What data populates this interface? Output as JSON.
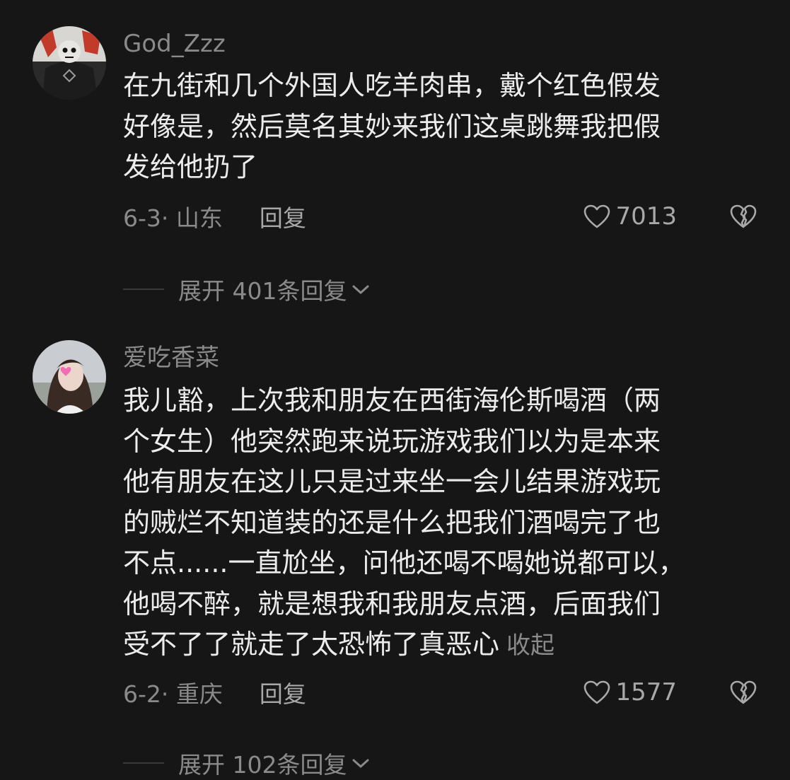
{
  "comments": [
    {
      "username": "God_Zzz",
      "lines": [
        "在九街和几个外国人吃羊肉串，戴个红色假发",
        "好像是，然后莫名其妙来我们这桌跳舞我把假",
        "发给他扔了"
      ],
      "collapse_label": "",
      "date_location": "6-3· 山东",
      "reply_label": "回复",
      "likes": "7013",
      "expand_label": "展开 401条回复"
    },
    {
      "username": "爱吃香菜",
      "lines": [
        "我儿豁，上次我和朋友在西街海伦斯喝酒（两",
        "个女生）他突然跑来说玩游戏我们以为是本来",
        "他有朋友在这儿只是过来坐一会儿结果游戏玩",
        "的贼烂不知道装的还是什么把我们酒喝完了也",
        "不点......一直尬坐，问他还喝不喝她说都可以，",
        "他喝不醉，就是想我和我朋友点酒，后面我们",
        "受不了了就走了太恐怖了真恶心"
      ],
      "collapse_label": "收起",
      "date_location": "6-2· 重庆",
      "reply_label": "回复",
      "likes": "1577",
      "expand_label": "展开 102条回复"
    }
  ],
  "icons": {
    "like": "heart-outline-icon",
    "dislike": "broken-heart-icon",
    "expand": "chevron-down-icon"
  },
  "colors": {
    "background": "#161616",
    "primary_text": "#ececec",
    "secondary_text": "#8a8a8a"
  }
}
